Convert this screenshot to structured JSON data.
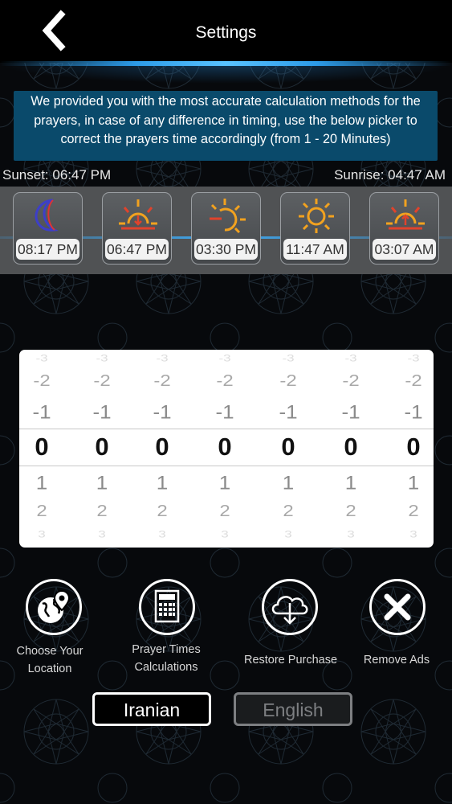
{
  "header": {
    "title": "Settings"
  },
  "info_text": "We provided you with the most accurate calculation methods for the prayers, in case of any difference in timing, use the below picker to correct the prayers time accordingly (from 1 - 20 Minutes)",
  "sun": {
    "sunset": "Sunset: 06:47 PM",
    "sunrise": "Sunrise: 04:47 AM"
  },
  "prayers": [
    {
      "icon": "moon-icon",
      "time": "08:17 PM"
    },
    {
      "icon": "sunset-icon",
      "time": "06:47 PM"
    },
    {
      "icon": "afternoon-sun-icon",
      "time": "03:30 PM"
    },
    {
      "icon": "noon-sun-icon",
      "time": "11:47 AM"
    },
    {
      "icon": "sunrise-icon",
      "time": "03:07 AM"
    }
  ],
  "picker": {
    "columns": [
      {
        "values": [
          "-3",
          "-2",
          "-1",
          "0",
          "1",
          "2",
          "3"
        ],
        "selected": "0"
      },
      {
        "values": [
          "-3",
          "-2",
          "-1",
          "0",
          "1",
          "2",
          "3"
        ],
        "selected": "0"
      },
      {
        "values": [
          "-3",
          "-2",
          "-1",
          "0",
          "1",
          "2",
          "3"
        ],
        "selected": "0"
      },
      {
        "values": [
          "-3",
          "-2",
          "-1",
          "0",
          "1",
          "2",
          "3"
        ],
        "selected": "0"
      },
      {
        "values": [
          "-3",
          "-2",
          "-1",
          "0",
          "1",
          "2",
          "3"
        ],
        "selected": "0"
      },
      {
        "values": [
          "-3",
          "-2",
          "-1",
          "0",
          "1",
          "2",
          "3"
        ],
        "selected": "0"
      },
      {
        "values": [
          "-3",
          "-2",
          "-1",
          "0",
          "1",
          "2",
          "3"
        ],
        "selected": "0"
      }
    ]
  },
  "actions": {
    "location": {
      "line1": "Choose Your",
      "line2": "Location",
      "icon": "location-globe-icon"
    },
    "calculations": {
      "line1": "Prayer Times",
      "line2": "Calculations",
      "icon": "calculator-icon"
    },
    "restore": {
      "label": "Restore Purchase",
      "icon": "cloud-download-icon"
    },
    "remove_ads": {
      "label": "Remove Ads",
      "icon": "close-icon"
    }
  },
  "languages": {
    "iranian": "Iranian",
    "english": "English",
    "selected": "Iranian"
  },
  "colors": {
    "accent_blue": "#2c9be8",
    "info_bg": "#0a4a6b",
    "strip_bg": "#505254"
  }
}
